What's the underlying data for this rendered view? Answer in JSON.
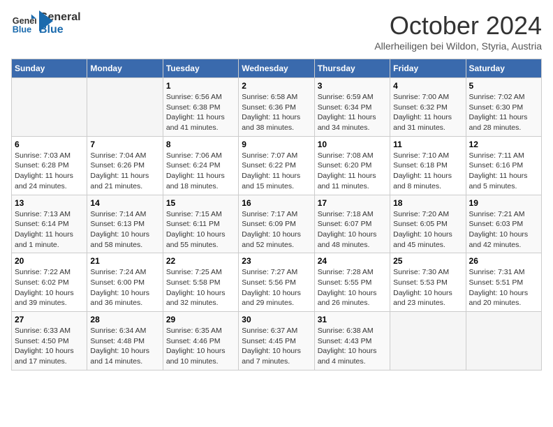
{
  "header": {
    "logo_general": "General",
    "logo_blue": "Blue",
    "month_title": "October 2024",
    "subtitle": "Allerheiligen bei Wildon, Styria, Austria"
  },
  "weekdays": [
    "Sunday",
    "Monday",
    "Tuesday",
    "Wednesday",
    "Thursday",
    "Friday",
    "Saturday"
  ],
  "weeks": [
    [
      {
        "day": "",
        "detail": ""
      },
      {
        "day": "",
        "detail": ""
      },
      {
        "day": "1",
        "detail": "Sunrise: 6:56 AM\nSunset: 6:38 PM\nDaylight: 11 hours and 41 minutes."
      },
      {
        "day": "2",
        "detail": "Sunrise: 6:58 AM\nSunset: 6:36 PM\nDaylight: 11 hours and 38 minutes."
      },
      {
        "day": "3",
        "detail": "Sunrise: 6:59 AM\nSunset: 6:34 PM\nDaylight: 11 hours and 34 minutes."
      },
      {
        "day": "4",
        "detail": "Sunrise: 7:00 AM\nSunset: 6:32 PM\nDaylight: 11 hours and 31 minutes."
      },
      {
        "day": "5",
        "detail": "Sunrise: 7:02 AM\nSunset: 6:30 PM\nDaylight: 11 hours and 28 minutes."
      }
    ],
    [
      {
        "day": "6",
        "detail": "Sunrise: 7:03 AM\nSunset: 6:28 PM\nDaylight: 11 hours and 24 minutes."
      },
      {
        "day": "7",
        "detail": "Sunrise: 7:04 AM\nSunset: 6:26 PM\nDaylight: 11 hours and 21 minutes."
      },
      {
        "day": "8",
        "detail": "Sunrise: 7:06 AM\nSunset: 6:24 PM\nDaylight: 11 hours and 18 minutes."
      },
      {
        "day": "9",
        "detail": "Sunrise: 7:07 AM\nSunset: 6:22 PM\nDaylight: 11 hours and 15 minutes."
      },
      {
        "day": "10",
        "detail": "Sunrise: 7:08 AM\nSunset: 6:20 PM\nDaylight: 11 hours and 11 minutes."
      },
      {
        "day": "11",
        "detail": "Sunrise: 7:10 AM\nSunset: 6:18 PM\nDaylight: 11 hours and 8 minutes."
      },
      {
        "day": "12",
        "detail": "Sunrise: 7:11 AM\nSunset: 6:16 PM\nDaylight: 11 hours and 5 minutes."
      }
    ],
    [
      {
        "day": "13",
        "detail": "Sunrise: 7:13 AM\nSunset: 6:14 PM\nDaylight: 11 hours and 1 minute."
      },
      {
        "day": "14",
        "detail": "Sunrise: 7:14 AM\nSunset: 6:13 PM\nDaylight: 10 hours and 58 minutes."
      },
      {
        "day": "15",
        "detail": "Sunrise: 7:15 AM\nSunset: 6:11 PM\nDaylight: 10 hours and 55 minutes."
      },
      {
        "day": "16",
        "detail": "Sunrise: 7:17 AM\nSunset: 6:09 PM\nDaylight: 10 hours and 52 minutes."
      },
      {
        "day": "17",
        "detail": "Sunrise: 7:18 AM\nSunset: 6:07 PM\nDaylight: 10 hours and 48 minutes."
      },
      {
        "day": "18",
        "detail": "Sunrise: 7:20 AM\nSunset: 6:05 PM\nDaylight: 10 hours and 45 minutes."
      },
      {
        "day": "19",
        "detail": "Sunrise: 7:21 AM\nSunset: 6:03 PM\nDaylight: 10 hours and 42 minutes."
      }
    ],
    [
      {
        "day": "20",
        "detail": "Sunrise: 7:22 AM\nSunset: 6:02 PM\nDaylight: 10 hours and 39 minutes."
      },
      {
        "day": "21",
        "detail": "Sunrise: 7:24 AM\nSunset: 6:00 PM\nDaylight: 10 hours and 36 minutes."
      },
      {
        "day": "22",
        "detail": "Sunrise: 7:25 AM\nSunset: 5:58 PM\nDaylight: 10 hours and 32 minutes."
      },
      {
        "day": "23",
        "detail": "Sunrise: 7:27 AM\nSunset: 5:56 PM\nDaylight: 10 hours and 29 minutes."
      },
      {
        "day": "24",
        "detail": "Sunrise: 7:28 AM\nSunset: 5:55 PM\nDaylight: 10 hours and 26 minutes."
      },
      {
        "day": "25",
        "detail": "Sunrise: 7:30 AM\nSunset: 5:53 PM\nDaylight: 10 hours and 23 minutes."
      },
      {
        "day": "26",
        "detail": "Sunrise: 7:31 AM\nSunset: 5:51 PM\nDaylight: 10 hours and 20 minutes."
      }
    ],
    [
      {
        "day": "27",
        "detail": "Sunrise: 6:33 AM\nSunset: 4:50 PM\nDaylight: 10 hours and 17 minutes."
      },
      {
        "day": "28",
        "detail": "Sunrise: 6:34 AM\nSunset: 4:48 PM\nDaylight: 10 hours and 14 minutes."
      },
      {
        "day": "29",
        "detail": "Sunrise: 6:35 AM\nSunset: 4:46 PM\nDaylight: 10 hours and 10 minutes."
      },
      {
        "day": "30",
        "detail": "Sunrise: 6:37 AM\nSunset: 4:45 PM\nDaylight: 10 hours and 7 minutes."
      },
      {
        "day": "31",
        "detail": "Sunrise: 6:38 AM\nSunset: 4:43 PM\nDaylight: 10 hours and 4 minutes."
      },
      {
        "day": "",
        "detail": ""
      },
      {
        "day": "",
        "detail": ""
      }
    ]
  ]
}
